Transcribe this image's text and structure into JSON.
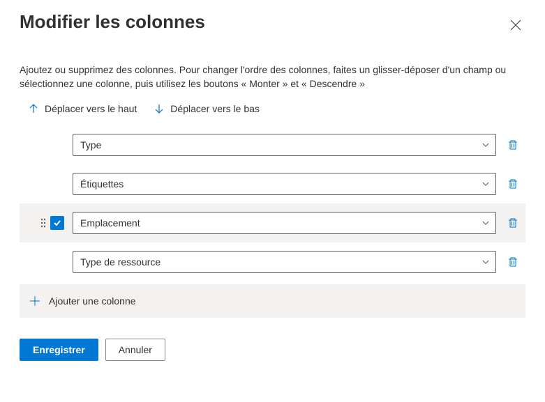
{
  "title": "Modifier les colonnes",
  "description": "Ajoutez ou supprimez des colonnes. Pour changer l'ordre des colonnes, faites un glisser-déposer d'un champ ou sélectionnez une colonne, puis utilisez les boutons « Monter » et « Descendre »",
  "move_up_label": "Déplacer vers le haut",
  "move_down_label": "Déplacer vers le bas",
  "columns": [
    {
      "value": "Type",
      "selected": false
    },
    {
      "value": "Étiquettes",
      "selected": false
    },
    {
      "value": "Emplacement",
      "selected": true
    },
    {
      "value": "Type de ressource",
      "selected": false
    }
  ],
  "add_column_label": "Ajouter une colonne",
  "save_label": "Enregistrer",
  "cancel_label": "Annuler"
}
